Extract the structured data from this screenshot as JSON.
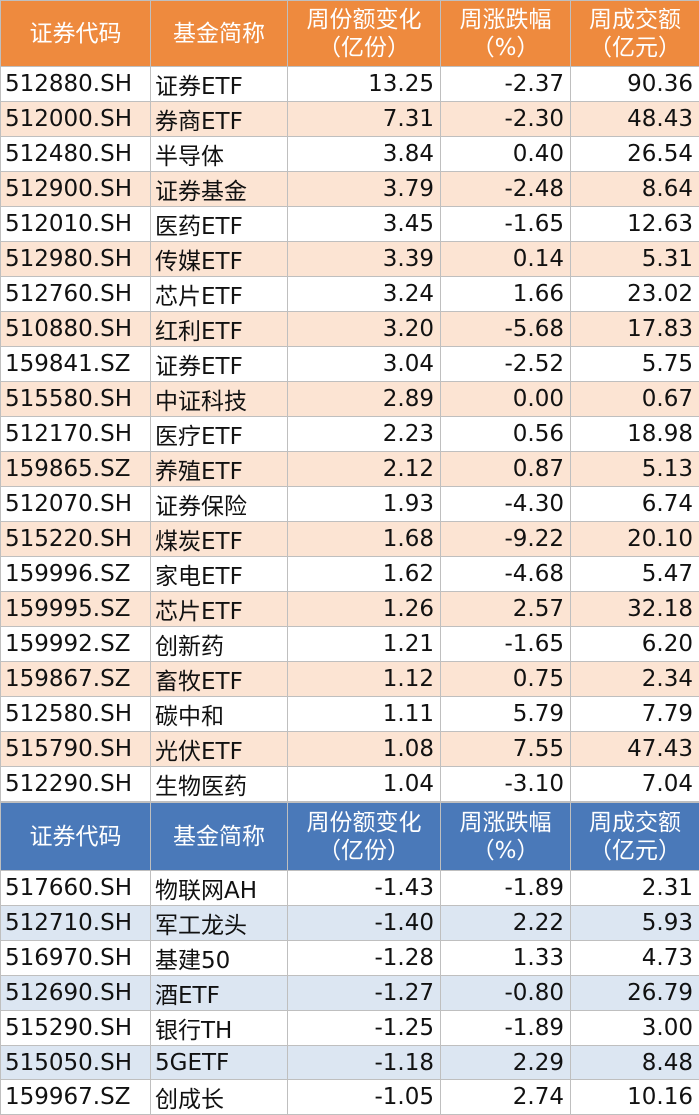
{
  "headers": {
    "code": "证券代码",
    "name": "基金简称",
    "share_change_l1": "周份额变化",
    "share_change_l2": "（亿份）",
    "pct_change_l1": "周涨跌幅",
    "pct_change_l2": "（%）",
    "turnover_l1": "周成交额",
    "turnover_l2": "（亿元）"
  },
  "top_rows": [
    {
      "code": "512880.SH",
      "name": "证券ETF",
      "share": "13.25",
      "pct": "-2.37",
      "turnover": "90.36"
    },
    {
      "code": "512000.SH",
      "name": "券商ETF",
      "share": "7.31",
      "pct": "-2.30",
      "turnover": "48.43"
    },
    {
      "code": "512480.SH",
      "name": "半导体",
      "share": "3.84",
      "pct": "0.40",
      "turnover": "26.54"
    },
    {
      "code": "512900.SH",
      "name": "证券基金",
      "share": "3.79",
      "pct": "-2.48",
      "turnover": "8.64"
    },
    {
      "code": "512010.SH",
      "name": "医药ETF",
      "share": "3.45",
      "pct": "-1.65",
      "turnover": "12.63"
    },
    {
      "code": "512980.SH",
      "name": "传媒ETF",
      "share": "3.39",
      "pct": "0.14",
      "turnover": "5.31"
    },
    {
      "code": "512760.SH",
      "name": "芯片ETF",
      "share": "3.24",
      "pct": "1.66",
      "turnover": "23.02"
    },
    {
      "code": "510880.SH",
      "name": "红利ETF",
      "share": "3.20",
      "pct": "-5.68",
      "turnover": "17.83"
    },
    {
      "code": "159841.SZ",
      "name": "证券ETF",
      "share": "3.04",
      "pct": "-2.52",
      "turnover": "5.75"
    },
    {
      "code": "515580.SH",
      "name": "中证科技",
      "share": "2.89",
      "pct": "0.00",
      "turnover": "0.67"
    },
    {
      "code": "512170.SH",
      "name": "医疗ETF",
      "share": "2.23",
      "pct": "0.56",
      "turnover": "18.98"
    },
    {
      "code": "159865.SZ",
      "name": "养殖ETF",
      "share": "2.12",
      "pct": "0.87",
      "turnover": "5.13"
    },
    {
      "code": "512070.SH",
      "name": "证券保险",
      "share": "1.93",
      "pct": "-4.30",
      "turnover": "6.74"
    },
    {
      "code": "515220.SH",
      "name": "煤炭ETF",
      "share": "1.68",
      "pct": "-9.22",
      "turnover": "20.10"
    },
    {
      "code": "159996.SZ",
      "name": "家电ETF",
      "share": "1.62",
      "pct": "-4.68",
      "turnover": "5.47"
    },
    {
      "code": "159995.SZ",
      "name": "芯片ETF",
      "share": "1.26",
      "pct": "2.57",
      "turnover": "32.18"
    },
    {
      "code": "159992.SZ",
      "name": "创新药",
      "share": "1.21",
      "pct": "-1.65",
      "turnover": "6.20"
    },
    {
      "code": "159867.SZ",
      "name": "畜牧ETF",
      "share": "1.12",
      "pct": "0.75",
      "turnover": "2.34"
    },
    {
      "code": "512580.SH",
      "name": "碳中和",
      "share": "1.11",
      "pct": "5.79",
      "turnover": "7.79"
    },
    {
      "code": "515790.SH",
      "name": "光伏ETF",
      "share": "1.08",
      "pct": "7.55",
      "turnover": "47.43"
    },
    {
      "code": "512290.SH",
      "name": "生物医药",
      "share": "1.04",
      "pct": "-3.10",
      "turnover": "7.04"
    }
  ],
  "bottom_rows": [
    {
      "code": "517660.SH",
      "name": "物联网AH",
      "share": "-1.43",
      "pct": "-1.89",
      "turnover": "2.31"
    },
    {
      "code": "512710.SH",
      "name": "军工龙头",
      "share": "-1.40",
      "pct": "2.22",
      "turnover": "5.93"
    },
    {
      "code": "516970.SH",
      "name": "基建50",
      "share": "-1.28",
      "pct": "1.33",
      "turnover": "4.73"
    },
    {
      "code": "512690.SH",
      "name": "酒ETF",
      "share": "-1.27",
      "pct": "-0.80",
      "turnover": "26.79"
    },
    {
      "code": "515290.SH",
      "name": "银行TH",
      "share": "-1.25",
      "pct": "-1.89",
      "turnover": "3.00"
    },
    {
      "code": "515050.SH",
      "name": "5GETF",
      "share": "-1.18",
      "pct": "2.29",
      "turnover": "8.48"
    },
    {
      "code": "159967.SZ",
      "name": "创成长",
      "share": "-1.05",
      "pct": "2.74",
      "turnover": "10.16"
    }
  ],
  "colors": {
    "top_header_bg": "#ee8a3e",
    "top_stripe": "#fce4d3",
    "bottom_header_bg": "#4a79b9",
    "bottom_stripe": "#dce6f2"
  }
}
